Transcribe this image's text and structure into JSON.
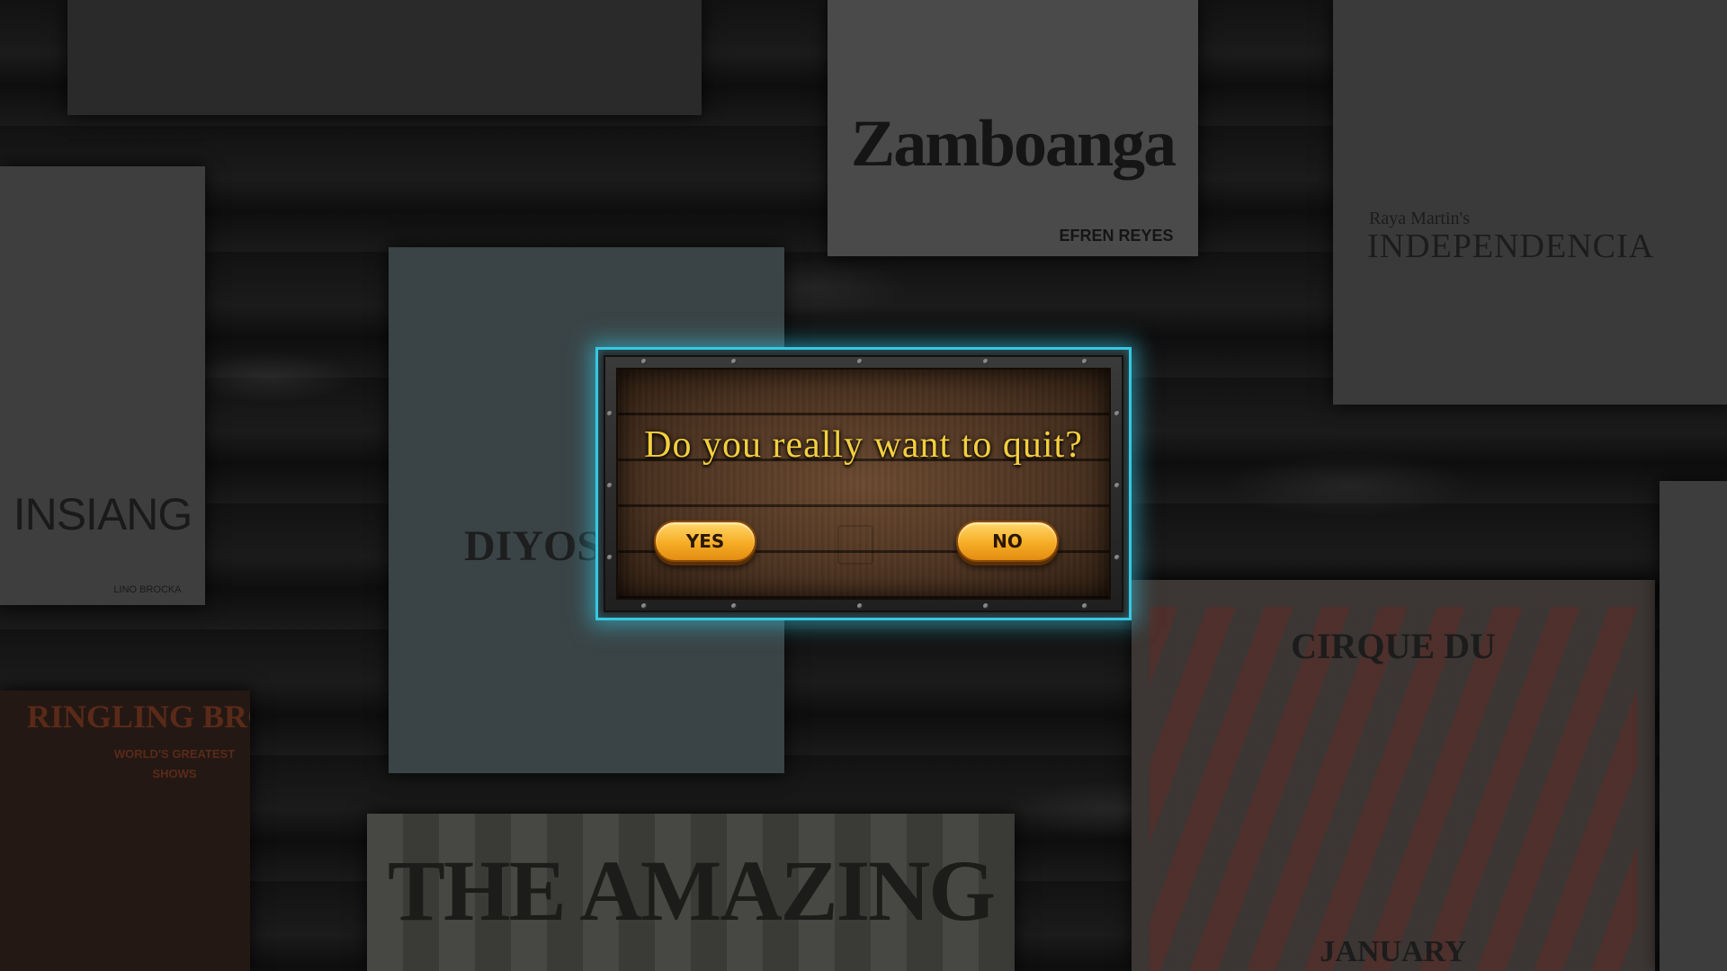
{
  "dialog": {
    "message": "Do you really want to quit?",
    "yes_label": "YES",
    "no_label": "NO",
    "glow_color": "#36c8e4",
    "text_color": "#f3cf3f",
    "button_color": "#f6ad26"
  },
  "posters": {
    "zamboanga": {
      "title": "Zamboanga",
      "director": "EFREN REYES"
    },
    "independencia": {
      "title": "INDEPENDENCIA",
      "subtitle": "Raya Martin's"
    },
    "insiang": {
      "title": "INSIANG",
      "director": "LINO BROCKA"
    },
    "diyos": {
      "title": "DIYOS"
    },
    "ringling": {
      "title": "RINGLING BROS.",
      "subtitle": "WORLD'S GREATEST SHOWS"
    },
    "amazing": {
      "title": "THE AMAZING"
    },
    "cirque": {
      "title": "CIRQUE DU",
      "subtitle": "JANUARY"
    }
  }
}
